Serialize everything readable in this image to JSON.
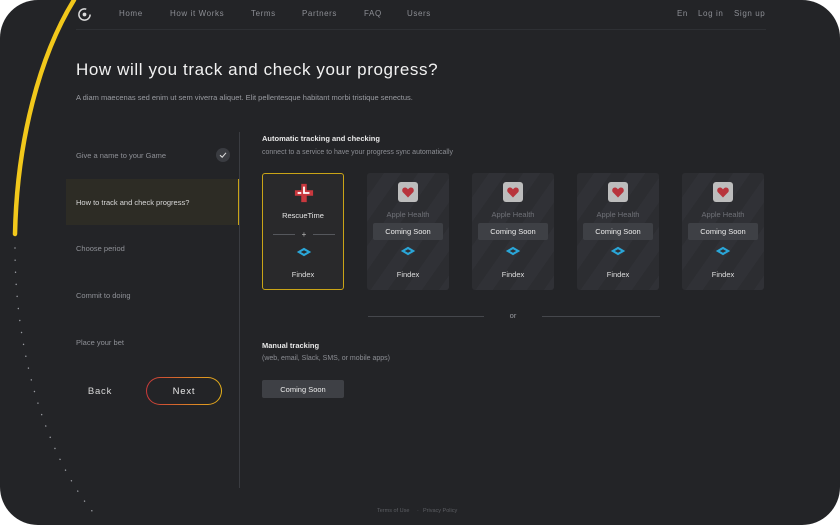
{
  "nav": {
    "items": [
      "Home",
      "How it Works",
      "Terms",
      "Partners",
      "FAQ",
      "Users"
    ],
    "lang": "En",
    "login": "Log in",
    "signup": "Sign up"
  },
  "header": {
    "title": "How will you track and check your progress?",
    "subtitle": "A diam maecenas sed enim ut sem viverra aliquet. Elit pellentesque habitant morbi tristique senectus."
  },
  "steps": [
    {
      "label": "Give a name to your Game",
      "completed": true
    },
    {
      "label": "How to track and check progress?",
      "active": true
    },
    {
      "label": "Choose period"
    },
    {
      "label": "Commit to doing"
    },
    {
      "label": "Place your bet"
    }
  ],
  "buttons": {
    "back": "Back",
    "next": "Next"
  },
  "automatic": {
    "title": "Automatic tracking and checking",
    "subtitle": "connect to a service to have your progress sync automatically",
    "cards": [
      {
        "name": "RescueTime",
        "partner": "Findex",
        "plus": "+",
        "selected": true,
        "icon": "rescuetime-icon"
      },
      {
        "name": "Apple Health",
        "partner": "Findex",
        "badge": "Coming Soon",
        "icon": "heart-icon"
      },
      {
        "name": "Apple Health",
        "partner": "Findex",
        "badge": "Coming Soon",
        "icon": "heart-icon"
      },
      {
        "name": "Apple Health",
        "partner": "Findex",
        "badge": "Coming Soon",
        "icon": "heart-icon"
      },
      {
        "name": "Apple Health",
        "partner": "Findex",
        "badge": "Coming Soon",
        "icon": "heart-icon"
      }
    ]
  },
  "or_label": "or",
  "manual": {
    "title": "Manual tracking",
    "subtitle": "(web, email, Slack, SMS, or mobile apps)",
    "button": "Coming Soon"
  },
  "footer": {
    "terms": "Terms of Use",
    "separator": "·",
    "privacy": "Privacy Policy"
  },
  "colors": {
    "background": "#232427",
    "accent_yellow": "#f2c81b",
    "active_border": "#c9a417",
    "next_gradient": [
      "#c8383a",
      "#e5b11a"
    ],
    "findex_blue": "#2aa6d8",
    "heart_red": "#b8343c"
  }
}
